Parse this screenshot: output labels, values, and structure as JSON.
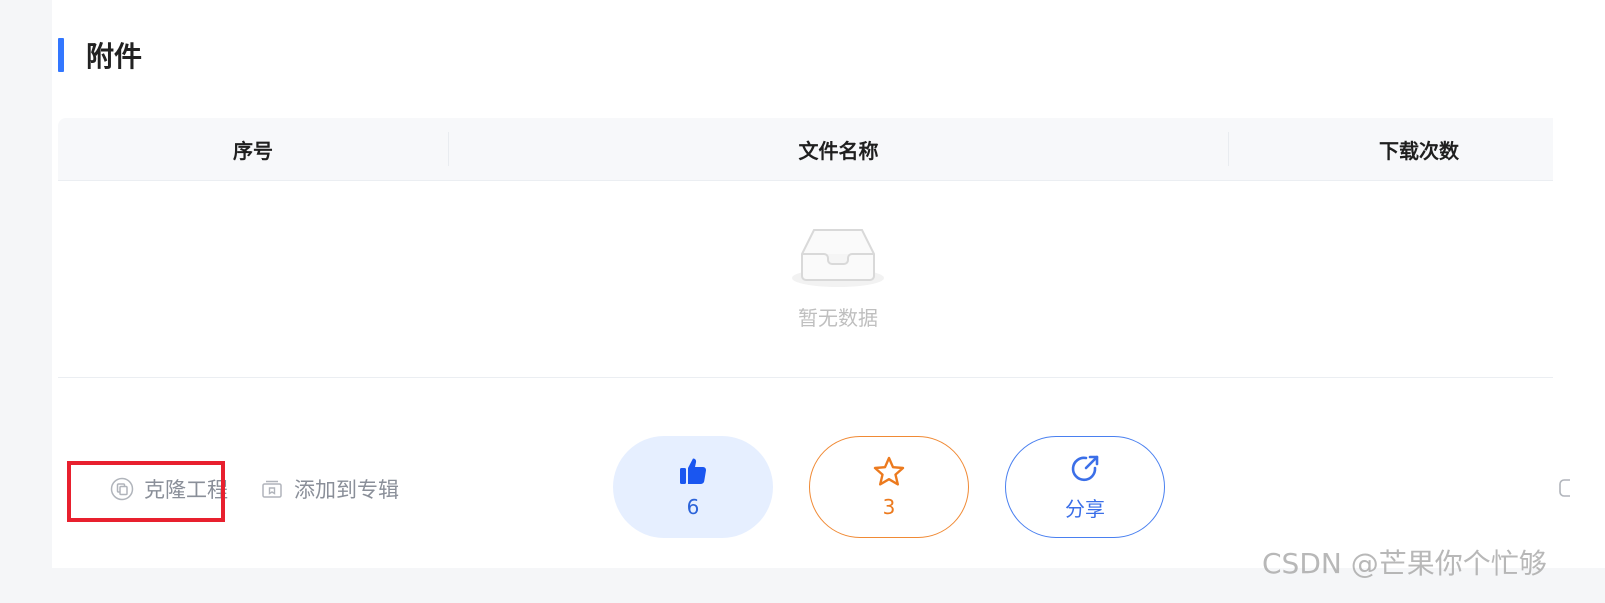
{
  "section": {
    "title": "附件"
  },
  "table": {
    "columns": [
      "序号",
      "文件名称",
      "下载次数"
    ],
    "empty_text": "暂无数据"
  },
  "actions": {
    "clone_label": "克隆工程",
    "add_to_album_label": "添加到专辑"
  },
  "buttons": {
    "like_count": "6",
    "favorite_count": "3",
    "share_label": "分享"
  },
  "watermark": "CSDN @芒果你个忙够",
  "colors": {
    "accent": "#3377ff",
    "highlight_box": "#e8202e",
    "like": "#2b63d9",
    "favorite": "#ec7a1e",
    "share": "#3b6fe8"
  },
  "icons": [
    "inbox-empty-icon",
    "clone-icon",
    "album-icon",
    "thumbs-up-icon",
    "star-icon",
    "share-icon"
  ]
}
